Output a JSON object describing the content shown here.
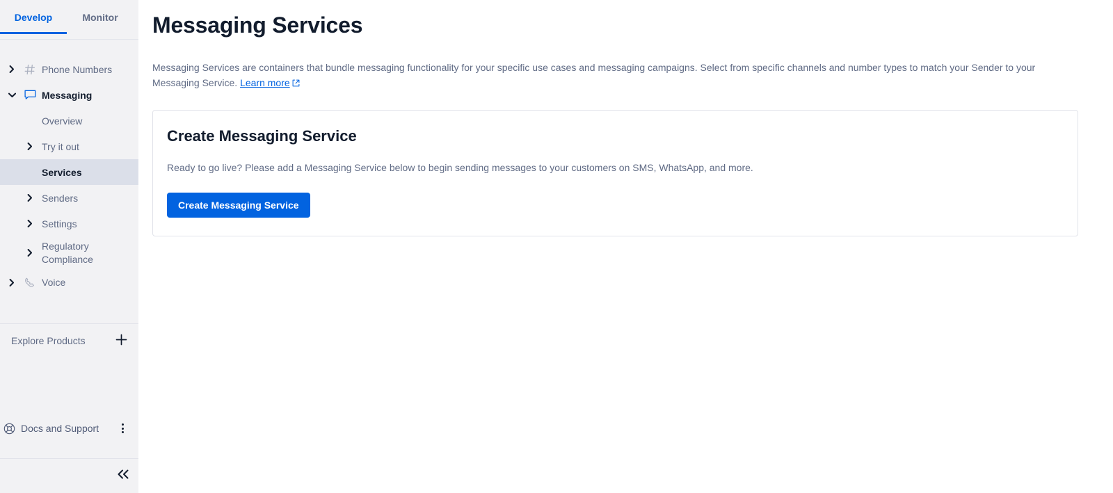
{
  "sidebar": {
    "tabs": [
      {
        "label": "Develop",
        "active": true
      },
      {
        "label": "Monitor",
        "active": false
      }
    ],
    "nav": [
      {
        "label": "Phone Numbers",
        "icon": "hash-icon",
        "level": 0,
        "expanded": false
      },
      {
        "label": "Messaging",
        "icon": "chat-bubble-icon",
        "level": 0,
        "expanded": true
      },
      {
        "label": "Overview",
        "level": 1,
        "caret": false,
        "selected": false
      },
      {
        "label": "Try it out",
        "level": 1,
        "caret": true,
        "selected": false
      },
      {
        "label": "Services",
        "level": 1,
        "caret": false,
        "selected": true
      },
      {
        "label": "Senders",
        "level": 1,
        "caret": true,
        "selected": false
      },
      {
        "label": "Settings",
        "level": 1,
        "caret": true,
        "selected": false
      },
      {
        "label": "Regulatory Compliance",
        "level": 1,
        "caret": true,
        "selected": false
      },
      {
        "label": "Voice",
        "icon": "phone-handset-icon",
        "level": 0,
        "expanded": false
      }
    ],
    "explore_products": {
      "label": "Explore Products",
      "add_icon": "plus-icon"
    },
    "docs_support": {
      "label": "Docs and Support",
      "icon": "lifebuoy-icon",
      "menu_icon": "kebab-menu-icon"
    },
    "collapse": {
      "icon": "double-chevron-left-icon"
    }
  },
  "main": {
    "title": "Messaging Services",
    "description_part1": "Messaging Services are containers that bundle messaging functionality for your specific use cases and messaging campaigns. Select from specific channels and number types to match your Sender to your Messaging Service. ",
    "learn_more_label": "Learn more",
    "card": {
      "title": "Create Messaging Service",
      "description": "Ready to go live? Please add a Messaging Service below to begin sending messages to your customers on SMS, WhatsApp, and more.",
      "button_label": "Create Messaging Service"
    }
  },
  "colors": {
    "accent": "#0263e0",
    "sidebar_bg": "#f2f2f4",
    "selected_bg": "#dbdfe9",
    "text_primary": "#121c2d",
    "text_secondary": "#606b85",
    "border": "#e1e3ea"
  }
}
